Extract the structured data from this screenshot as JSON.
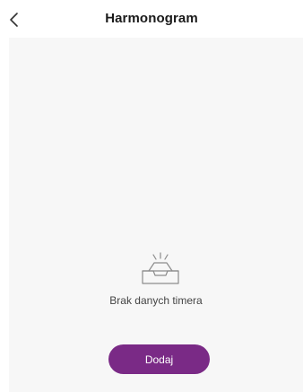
{
  "header": {
    "title": "Harmonogram",
    "back_icon": "chevron-left-icon"
  },
  "empty_state": {
    "icon": "empty-inbox-icon",
    "message": "Brak danych timera"
  },
  "actions": {
    "add_label": "Dodaj"
  },
  "colors": {
    "accent": "#7a2a86",
    "content_background": "#f7f7f7",
    "title_text": "#1a1a1a",
    "message_text": "#444444"
  }
}
